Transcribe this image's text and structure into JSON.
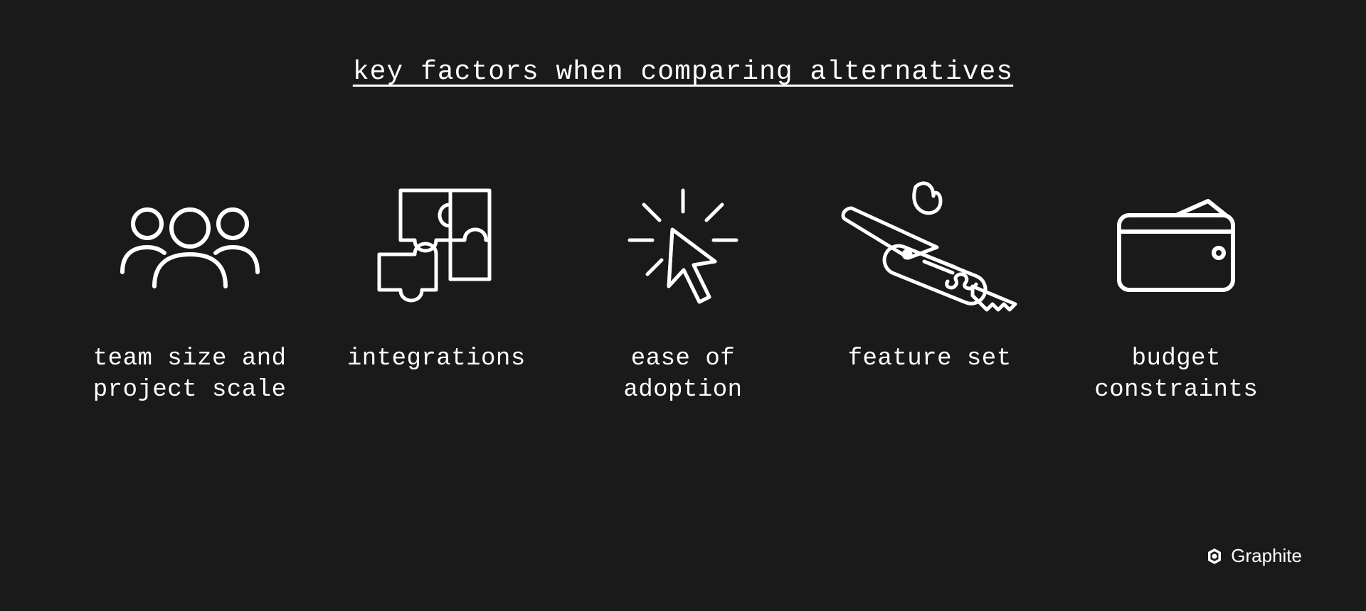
{
  "title": "key factors when comparing alternatives",
  "factors": [
    {
      "label": "team size and project scale",
      "icon": "people-icon"
    },
    {
      "label": "integrations",
      "icon": "puzzle-icon"
    },
    {
      "label": "ease of adoption",
      "icon": "cursor-click-icon"
    },
    {
      "label": "feature set",
      "icon": "swiss-knife-icon"
    },
    {
      "label": "budget constraints",
      "icon": "wallet-icon"
    }
  ],
  "brand": {
    "name": "Graphite"
  },
  "colors": {
    "bg": "#1a1a1a",
    "fg": "#ffffff"
  }
}
